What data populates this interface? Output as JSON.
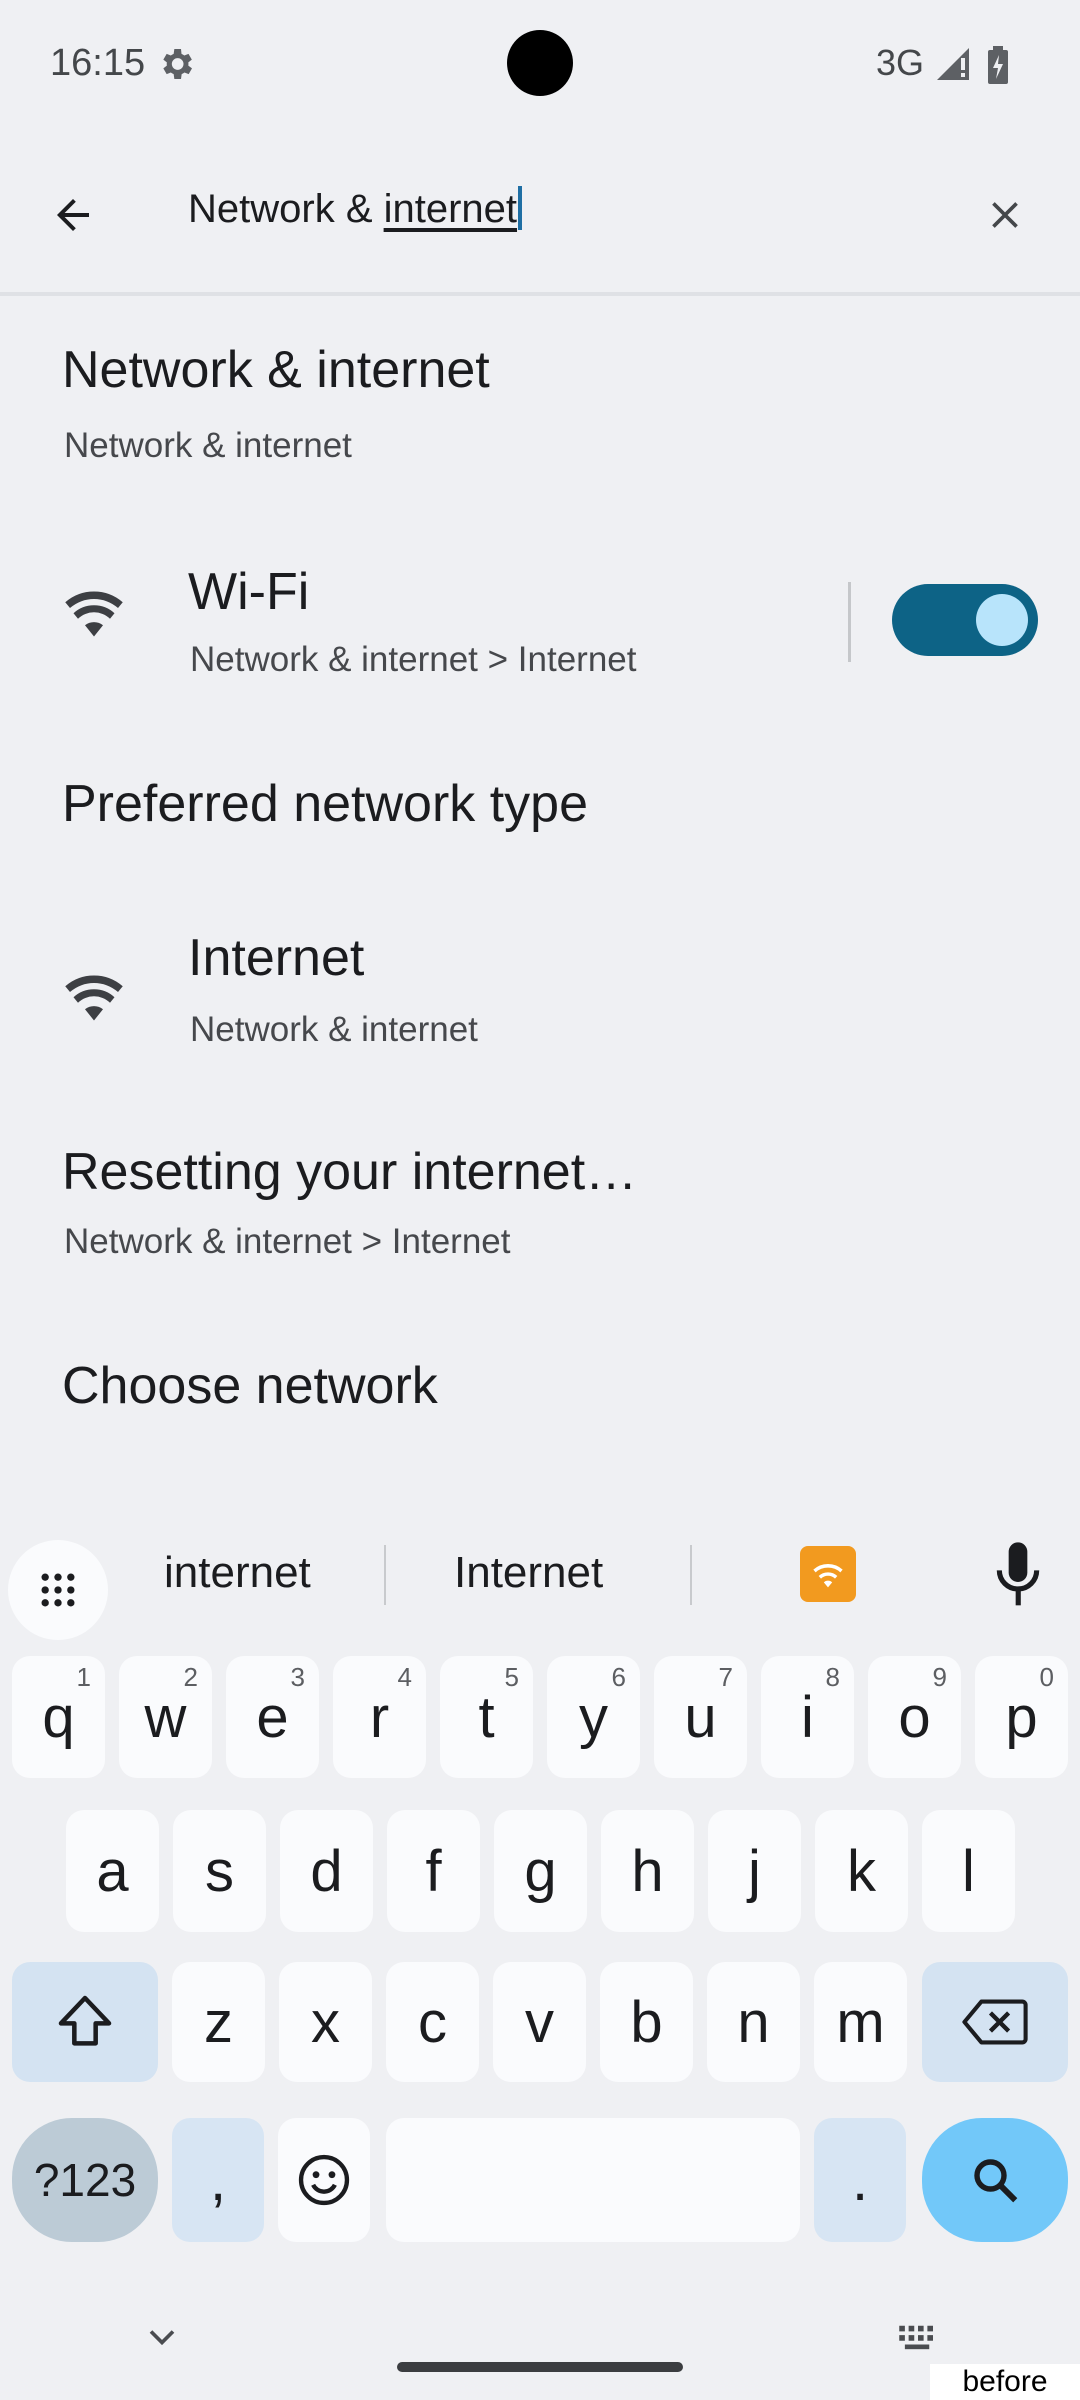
{
  "status_bar": {
    "time": "16:15",
    "network": "3G",
    "icons": [
      "gear-icon",
      "signal-icon",
      "battery-icon"
    ]
  },
  "search": {
    "query_prefix": "Network & ",
    "query_underlined": "internet",
    "back_icon": "arrow-back-icon",
    "clear_icon": "close-icon"
  },
  "results": [
    {
      "title": "Network & internet",
      "subtitle": "Network & internet"
    },
    {
      "title": "Wi-Fi",
      "subtitle": "Network & internet > Internet",
      "icon": "wifi-icon",
      "toggle_on": true
    },
    {
      "title": "Preferred network type"
    },
    {
      "title": "Internet",
      "subtitle": "Network & internet",
      "icon": "wifi-icon"
    },
    {
      "title": "Resetting your internet…",
      "subtitle": "Network & internet > Internet"
    },
    {
      "title": "Choose network"
    }
  ],
  "keyboard": {
    "suggestions": [
      "internet",
      "Internet"
    ],
    "suggestion_emoji": "wifi-emoji",
    "row1": [
      "q",
      "w",
      "e",
      "r",
      "t",
      "y",
      "u",
      "i",
      "o",
      "p"
    ],
    "row1_hints": [
      "1",
      "2",
      "3",
      "4",
      "5",
      "6",
      "7",
      "8",
      "9",
      "0"
    ],
    "row2": [
      "a",
      "s",
      "d",
      "f",
      "g",
      "h",
      "j",
      "k",
      "l"
    ],
    "row3": [
      "z",
      "x",
      "c",
      "v",
      "b",
      "n",
      "m"
    ],
    "symbols_label": "?123",
    "comma": ",",
    "period": "."
  },
  "overlay_label": "before",
  "colors": {
    "toggle_track": "#0d6386",
    "toggle_knob": "#b8e4fb",
    "search_key": "#72c8f9",
    "accent_cursor": "#1f6fa4"
  }
}
